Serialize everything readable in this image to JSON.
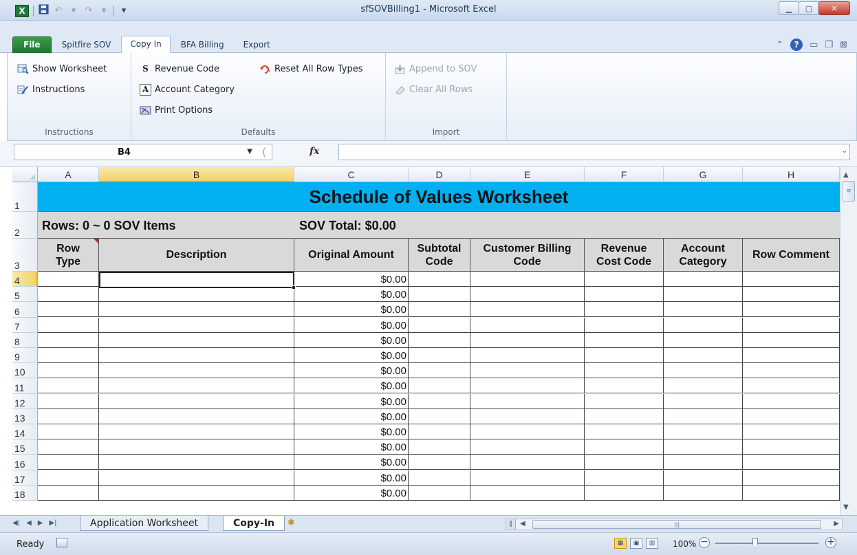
{
  "window": {
    "title": "sfSOVBilling1  -  Microsoft Excel",
    "app_icon": "X"
  },
  "ribbon_tabs": [
    "File",
    "Spitfire SOV",
    "Copy In",
    "BFA Billing",
    "Export"
  ],
  "ribbon": {
    "instructions_group": {
      "label": "Instructions",
      "show_worksheet": "Show Worksheet",
      "instructions": "Instructions"
    },
    "defaults_group": {
      "label": "Defaults",
      "revenue_code": "Revenue Code",
      "account_category": "Account Category",
      "print_options": "Print Options",
      "reset_all_row_types": "Reset All Row Types"
    },
    "import_group": {
      "label": "Import",
      "append_to_sov": "Append to SOV",
      "clear_all_rows": "Clear All Rows"
    }
  },
  "formula_bar": {
    "name_box": "B4",
    "fx": "fx",
    "formula": ""
  },
  "columns": [
    "A",
    "B",
    "C",
    "D",
    "E",
    "F",
    "G",
    "H"
  ],
  "selected_column": "B",
  "sheet": {
    "banner": "Schedule of Values Worksheet",
    "rows_summary": "Rows: 0 ~ 0 SOV Items",
    "sov_total": "SOV Total: $0.00",
    "headers": [
      "Row\nType",
      "Description",
      "Original Amount",
      "Subtotal\nCode",
      "Customer Billing\nCode",
      "Revenue\nCost Code",
      "Account\nCategory",
      "Row Comment"
    ],
    "row_numbers": [
      "1",
      "2",
      "3",
      "4",
      "5",
      "6",
      "7",
      "8",
      "9",
      "10",
      "11",
      "12",
      "13",
      "14",
      "15",
      "16",
      "17",
      "18"
    ],
    "amount_value": "$0.00"
  },
  "sheet_tabs": {
    "tab1": "Application Worksheet",
    "tab2": "Copy-In"
  },
  "status_bar": {
    "status": "Ready",
    "zoom": "100%"
  },
  "colors": {
    "banner": "#00b0f0",
    "header_fill": "#d9d9d9",
    "excel_green": "#1f7332"
  }
}
